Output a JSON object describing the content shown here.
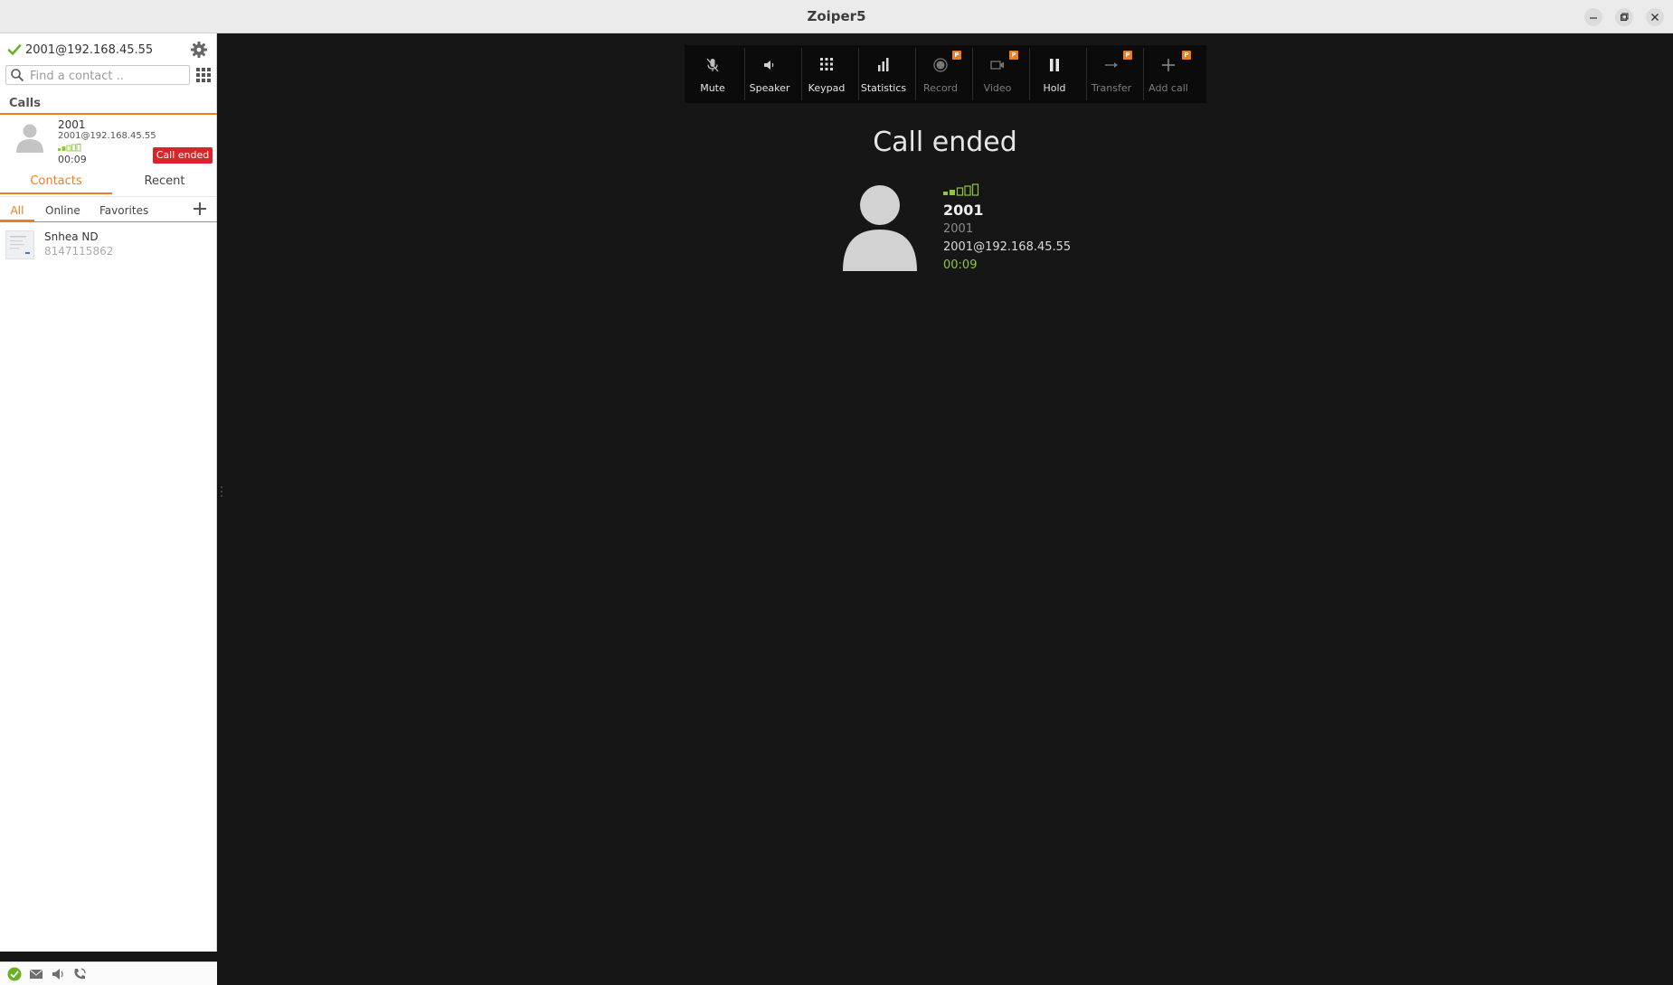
{
  "window": {
    "title": "Zoiper5"
  },
  "account": {
    "address": "2001@192.168.45.55"
  },
  "search": {
    "placeholder": "Find a contact .."
  },
  "calls": {
    "heading": "Calls",
    "items": [
      {
        "number": "2001",
        "address": "2001@192.168.45.55",
        "duration": "00:09",
        "status": "Call ended"
      }
    ]
  },
  "tabs": {
    "contacts": "Contacts",
    "recent": "Recent"
  },
  "filters": {
    "all": "All",
    "online": "Online",
    "favorites": "Favorites"
  },
  "contacts": [
    {
      "name": "Snhea ND",
      "number": "8147115862"
    }
  ],
  "toolbar": {
    "mute": "Mute",
    "speaker": "Speaker",
    "keypad": "Keypad",
    "statistics": "Statistics",
    "record": "Record",
    "video": "Video",
    "hold": "Hold",
    "transfer": "Transfer",
    "add_call": "Add call",
    "pro_badge": "P"
  },
  "call_panel": {
    "status": "Call ended",
    "name": "2001",
    "number": "2001",
    "address": "2001@192.168.45.55",
    "duration": "00:09"
  },
  "colors": {
    "accent": "#f07c1b",
    "ok": "#6ab023",
    "ended": "#d6252b",
    "duration": "#8fc63f"
  }
}
